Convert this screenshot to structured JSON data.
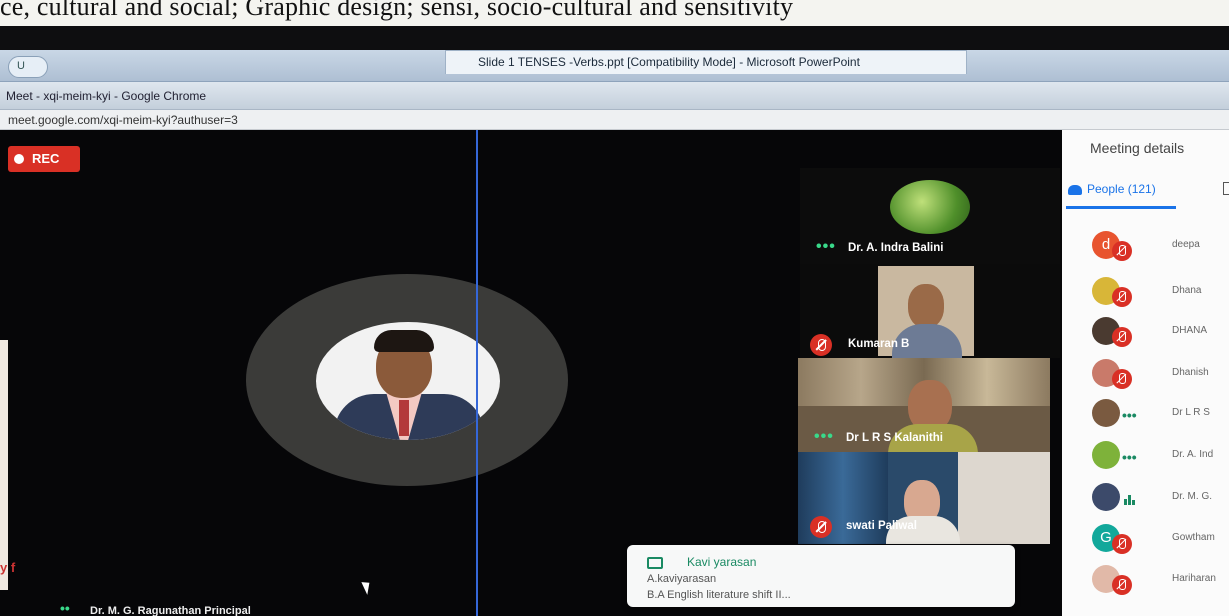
{
  "document_strip": {
    "text": "ce, cultural and social; Graphic design; sensi, socio-cultural and sensitivity"
  },
  "powerpoint": {
    "title": "Slide 1 TENSES -Verbs.ppt [Compatibility Mode] - Microsoft PowerPoint",
    "quick_access": "U"
  },
  "chrome": {
    "window_title": "Meet - xqi-meim-kyi - Google Chrome",
    "url": "meet.google.com/xqi-meim-kyi?authuser=3"
  },
  "meet": {
    "rec_label": "REC",
    "tiles": [
      {
        "name": "Dr. A. Indra Balini",
        "indicator": "speaking-dots"
      },
      {
        "name": "Kumaran B",
        "indicator": "mic-off"
      },
      {
        "name": "Dr L R S Kalanithi",
        "indicator": "speaking-dots"
      },
      {
        "name": "swati Paliwal",
        "indicator": "mic-off"
      }
    ],
    "chat_toast": {
      "title": "Kavi yarasan",
      "sender": "A.kaviyarasan",
      "message": "B.A English literature shift II..."
    },
    "bottom_speaker": "Dr. M. G. Ragunathan Principal",
    "left_peek_text": "y f"
  },
  "side_panel": {
    "title": "Meeting details",
    "people_tab": "People (121)",
    "participants": [
      {
        "name": "deepa",
        "avatar": "letter",
        "letter": "d",
        "color": "#e8542f",
        "status": "mic-off"
      },
      {
        "name": "Dhana",
        "avatar": "photo",
        "color": "#d8b638",
        "status": "mic-off"
      },
      {
        "name": "DHANA",
        "avatar": "photo",
        "color": "#4a3a30",
        "status": "mic-off"
      },
      {
        "name": "Dhanish",
        "avatar": "photo",
        "color": "#c97a6a",
        "status": "mic-off"
      },
      {
        "name": "Dr L R S",
        "avatar": "photo",
        "color": "#7a5a40",
        "status": "dots"
      },
      {
        "name": "Dr. A. Ind",
        "avatar": "photo",
        "color": "#7eb23a",
        "status": "dots"
      },
      {
        "name": "Dr. M. G.",
        "avatar": "photo",
        "color": "#3c4a6a",
        "status": "bars"
      },
      {
        "name": "Gowtham",
        "avatar": "letter",
        "letter": "G",
        "color": "#12a89b",
        "status": "mic-off"
      },
      {
        "name": "Hariharan",
        "avatar": "photo",
        "color": "#e1b9a8",
        "status": "mic-off"
      }
    ]
  }
}
